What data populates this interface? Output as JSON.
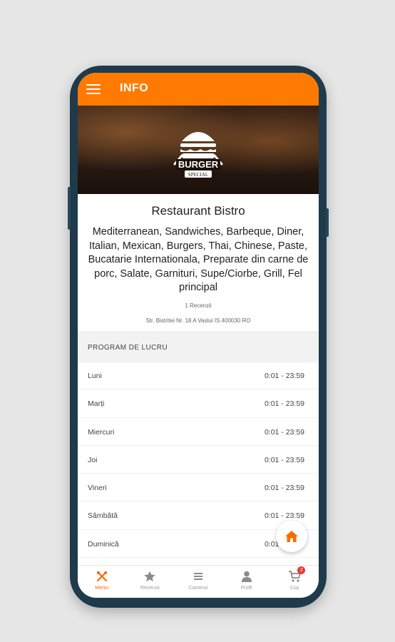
{
  "appbar": {
    "title": "INFO"
  },
  "hero": {
    "logo_line1": "BURGER",
    "logo_line2": "SPECIAL"
  },
  "restaurant": {
    "name": "Restaurant Bistro",
    "cuisines": "Mediterranean, Sandwiches, Barbeque, Diner, Italian, Mexican, Burgers, Thai, Chinese, Paste, Bucatarie Internationala, Preparate din carne de porc, Salate, Garnituri, Supe/Ciorbe, Grill, Fel principal",
    "reviews": "1 Recenzii",
    "address": "Str. Bistritei Nr. 18 A Vaslui IS 400030 RO"
  },
  "schedule": {
    "header": "PROGRAM DE LUCRU",
    "days": [
      {
        "day": "Luni",
        "hours": "0:01 - 23:59"
      },
      {
        "day": "Marți",
        "hours": "0:01 - 23:59"
      },
      {
        "day": "Miercuri",
        "hours": "0:01 - 23:59"
      },
      {
        "day": "Joi",
        "hours": "0:01 - 23:59"
      },
      {
        "day": "Vineri",
        "hours": "0:01 - 23:59"
      },
      {
        "day": "Sâmbătă",
        "hours": "0:01 - 23:59"
      },
      {
        "day": "Duminică",
        "hours": "0:01 - 23:59"
      }
    ]
  },
  "bottom_nav": {
    "items": [
      {
        "label": "Meniu",
        "icon": "cutlery-icon"
      },
      {
        "label": "Recenzii",
        "icon": "star-icon"
      },
      {
        "label": "Comenzi",
        "icon": "list-icon"
      },
      {
        "label": "Profil",
        "icon": "person-icon"
      },
      {
        "label": "Coș",
        "icon": "cart-icon",
        "badge": "2"
      }
    ]
  },
  "colors": {
    "accent": "#ff7a00",
    "badge": "#e53935"
  }
}
